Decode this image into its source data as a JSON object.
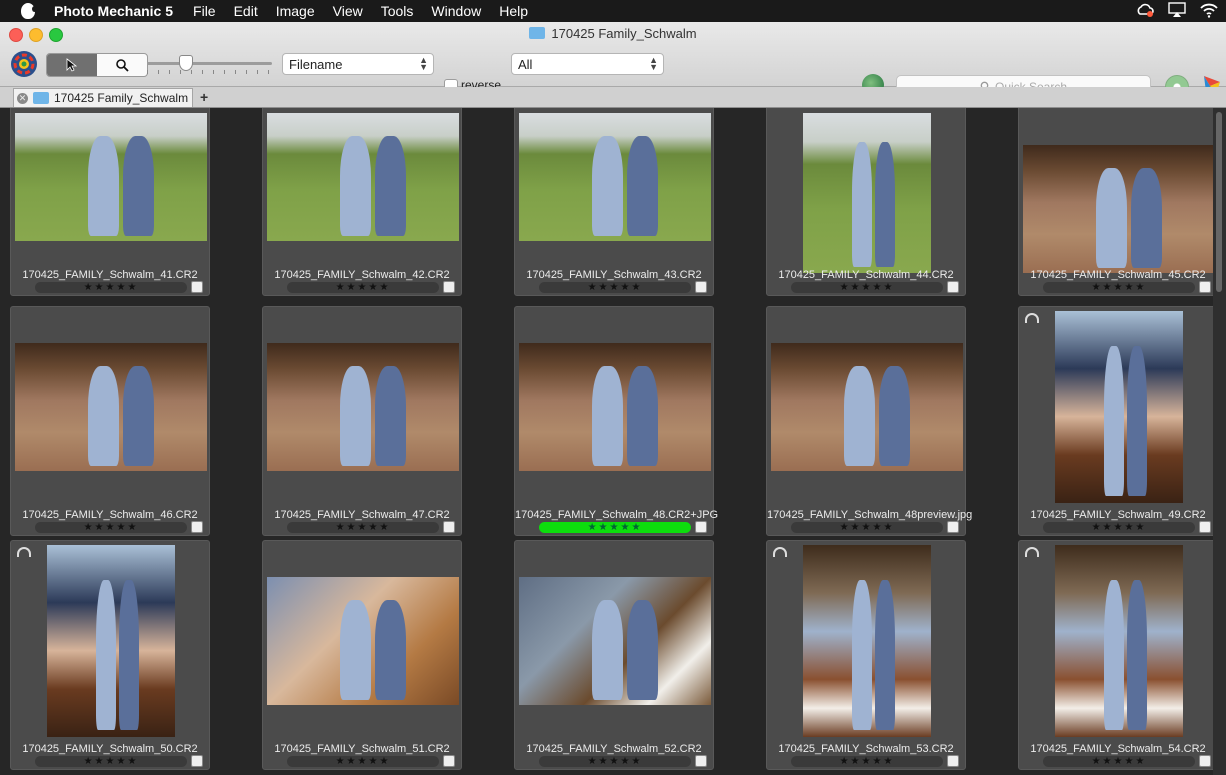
{
  "menubar": {
    "app_name": "Photo Mechanic 5",
    "items": [
      "File",
      "Edit",
      "Image",
      "View",
      "Tools",
      "Window",
      "Help"
    ]
  },
  "window": {
    "title": "170425 Family_Schwalm"
  },
  "toolbar": {
    "sort_field": "Filename",
    "reverse_label": "reverse",
    "filter_value": "All",
    "search_placeholder": "Quick Search"
  },
  "tabs": [
    {
      "label": "170425 Family_Schwalm"
    }
  ],
  "grid": {
    "cells": [
      {
        "filename": "170425_FAMILY_Schwalm_41.CR2",
        "stars": "★★★★★",
        "tagged": false,
        "rotated": false,
        "photo": "field"
      },
      {
        "filename": "170425_FAMILY_Schwalm_42.CR2",
        "stars": "★★★★★",
        "tagged": false,
        "rotated": false,
        "photo": "field"
      },
      {
        "filename": "170425_FAMILY_Schwalm_43.CR2",
        "stars": "★★★★★",
        "tagged": false,
        "rotated": false,
        "photo": "field"
      },
      {
        "filename": "170425_FAMILY_Schwalm_44.CR2",
        "stars": "★★★★★",
        "tagged": false,
        "rotated": false,
        "photo": "field-tall"
      },
      {
        "filename": "170425_FAMILY_Schwalm_45.CR2",
        "stars": "★★★★★",
        "tagged": false,
        "rotated": false,
        "photo": "barn"
      },
      {
        "filename": "170425_FAMILY_Schwalm_46.CR2",
        "stars": "★★★★★",
        "tagged": false,
        "rotated": false,
        "photo": "barn"
      },
      {
        "filename": "170425_FAMILY_Schwalm_47.CR2",
        "stars": "★★★★★",
        "tagged": false,
        "rotated": false,
        "photo": "barn"
      },
      {
        "filename": "170425_FAMILY_Schwalm_48.CR2+JPG",
        "stars": "★★★★★",
        "tagged": false,
        "rotated": false,
        "photo": "barn",
        "highlight": true
      },
      {
        "filename": "170425_FAMILY_Schwalm_48preview.jpg",
        "stars": "★★★★★",
        "tagged": false,
        "rotated": false,
        "photo": "barn"
      },
      {
        "filename": "170425_FAMILY_Schwalm_49.CR2",
        "stars": "★★★★★",
        "tagged": false,
        "rotated": true,
        "photo": "tall1"
      },
      {
        "filename": "170425_FAMILY_Schwalm_50.CR2",
        "stars": "★★★★★",
        "tagged": false,
        "rotated": true,
        "photo": "tall1"
      },
      {
        "filename": "170425_FAMILY_Schwalm_51.CR2",
        "stars": "★★★★★",
        "tagged": false,
        "rotated": false,
        "photo": "blur1"
      },
      {
        "filename": "170425_FAMILY_Schwalm_52.CR2",
        "stars": "★★★★★",
        "tagged": false,
        "rotated": false,
        "photo": "blur2"
      },
      {
        "filename": "170425_FAMILY_Schwalm_53.CR2",
        "stars": "★★★★★",
        "tagged": false,
        "rotated": true,
        "photo": "rider"
      },
      {
        "filename": "170425_FAMILY_Schwalm_54.CR2",
        "stars": "★★★★★",
        "tagged": false,
        "rotated": true,
        "photo": "rider"
      }
    ]
  },
  "colors": {
    "highlight_rating": "#0ddd0d",
    "cell_bg": "#4b4b4b",
    "grid_bg": "#262626"
  }
}
